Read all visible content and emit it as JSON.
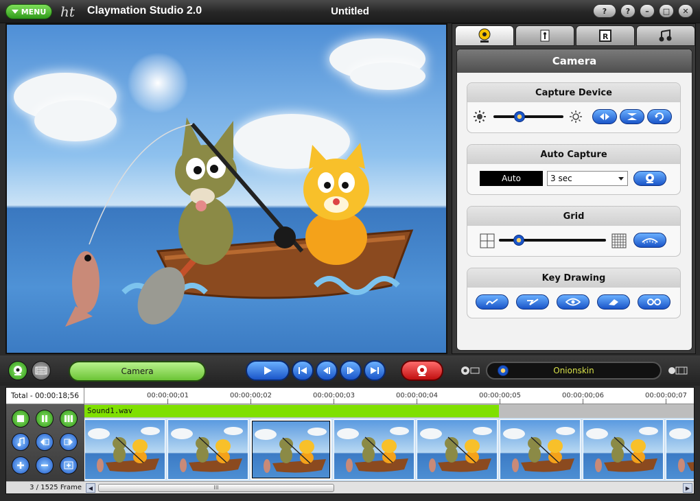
{
  "window": {
    "menu_label": "MENU",
    "logo_text": "ht",
    "app_title": "Claymation Studio 2.0",
    "doc_title": "Untitled",
    "buttons": [
      "?",
      "?",
      "–",
      "□",
      "✕"
    ]
  },
  "right_panel": {
    "tabs": [
      "camera-tab",
      "figure-tab",
      "r-tab",
      "music-tab"
    ],
    "active_tab": "camera-tab",
    "heading": "Camera",
    "capture_device": {
      "title": "Capture Device",
      "brightness_level": 0.35
    },
    "auto_capture": {
      "title": "Auto Capture",
      "mode_value": "Auto",
      "interval_value": "3 sec"
    },
    "grid": {
      "title": "Grid",
      "grid_level": 0.15
    },
    "key_drawing": {
      "title": "Key Drawing"
    }
  },
  "controlbar": {
    "mode_label": "Camera",
    "onion_label": "Onionskin",
    "onion_level": 0.05
  },
  "timeline": {
    "total_label": "Total - 00:00:18;56",
    "ticks": [
      "00:00:00;01",
      "00:00:00;02",
      "00:00:00;03",
      "00:00:00;04",
      "00:00:00;05",
      "00:00:00;06",
      "00:00:00;07"
    ],
    "sound_label": "Sound1.wav",
    "frame_label": "3 / 1525 Frame",
    "frame_count_visible": 8,
    "selected_frame": 3,
    "scroll_grip": "III"
  },
  "colors": {
    "accent_green": "#6cc436",
    "accent_blue": "#1a55c8",
    "record_red": "#c01010",
    "sound_bar": "#7fe000"
  }
}
